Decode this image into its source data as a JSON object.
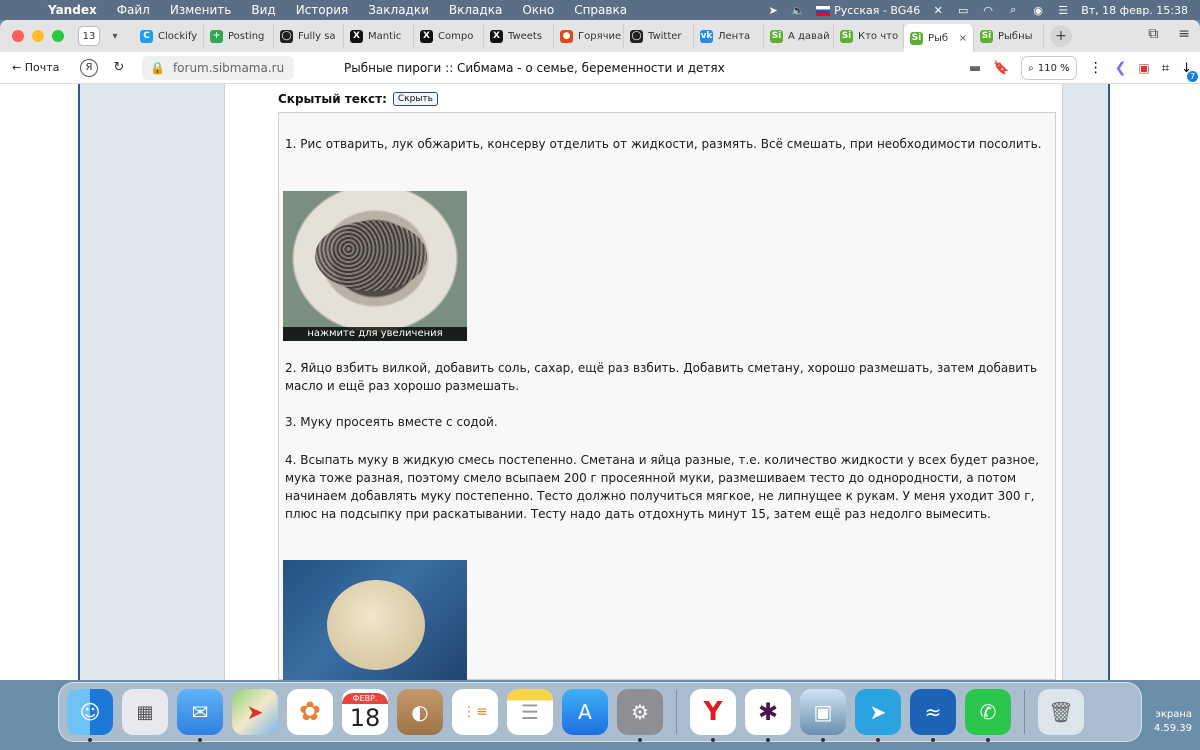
{
  "menubar": {
    "app": "Yandex",
    "items": [
      "Файл",
      "Изменить",
      "Вид",
      "История",
      "Закладки",
      "Вкладка",
      "Окно",
      "Справка"
    ],
    "input_source": "Русская - BG46",
    "datetime": "Вт, 18 февр.  15:38"
  },
  "tabs": {
    "count": "13",
    "items": [
      {
        "label": "Clockify",
        "fav": "C",
        "color": "#1e9ef0"
      },
      {
        "label": "Posting",
        "fav": "+",
        "color": "#2fa84f"
      },
      {
        "label": "Fully sa",
        "fav": "◯",
        "color": "#222222"
      },
      {
        "label": "Mantic",
        "fav": "X",
        "color": "#111111"
      },
      {
        "label": "Compo",
        "fav": "X",
        "color": "#111111"
      },
      {
        "label": "Tweets",
        "fav": "X",
        "color": "#111111"
      },
      {
        "label": "Горячие",
        "fav": "●",
        "color": "#e04a1f"
      },
      {
        "label": "Twitter",
        "fav": "◯",
        "color": "#222222"
      },
      {
        "label": "Лента",
        "fav": "vk",
        "color": "#2787f5"
      },
      {
        "label": "А давай",
        "fav": "Si",
        "color": "#5cb030"
      },
      {
        "label": "Кто что",
        "fav": "Si",
        "color": "#5cb030"
      },
      {
        "label": "Рыб",
        "fav": "Si",
        "color": "#5cb030",
        "active": true
      },
      {
        "label": "Рыбны",
        "fav": "Si",
        "color": "#5cb030"
      }
    ]
  },
  "toolbar": {
    "back_label": "← Почта",
    "yandex_btn": "Я",
    "url": "forum.sibmama.ru",
    "page_title": "Рыбные пироги :: Сибмама - о семье, беременности и детях",
    "zoom": "110 %",
    "downloads_badge": "7"
  },
  "post": {
    "spoiler_label": "Скрытый текст:",
    "spoiler_button": "Скрыть",
    "step1": "1. Рис отварить, лук обжарить, консерву отделить от жидкости, размять. Всё смешать, при необходимости посолить.",
    "photo_caption": "нажмите для увеличения",
    "step2": "2. Яйцо взбить вилкой, добавить соль, сахар, ещё раз взбить. Добавить сметану, хорошо размешать, затем добавить масло и ещё раз хорошо размешать.",
    "step3": "3. Муку просеять вместе с содой.",
    "step4": "4. Всыпать муку в жидкую смесь постепенно. Сметана и яйца разные, т.е. количество жидкости у всех будет разное, мука тоже разная, поэтому смело всыпаем 200 г просеянной муки, размешиваем тесто до однородности, а потом начинаем добавлять муку постепенно. Тесто должно получиться мягкое, не липнущее к рукам. У меня уходит 300 г, плюс на подсыпку при раскатывании. Тесту надо дать отдохнуть минут 15, затем ещё раз недолго вымесить."
  },
  "dock": {
    "calendar_month": "ФЕВР.",
    "calendar_day": "18",
    "apps": [
      "finder",
      "launchpad",
      "mail",
      "maps",
      "photos",
      "calendar",
      "contacts",
      "reminders",
      "notes",
      "app-store",
      "system-settings",
      "yandex-browser",
      "slack",
      "preview",
      "telegram",
      "openoffice",
      "whatsapp",
      "trash"
    ]
  },
  "desktop": {
    "label_line1": "экрана",
    "label_line2": "4.59.39"
  }
}
